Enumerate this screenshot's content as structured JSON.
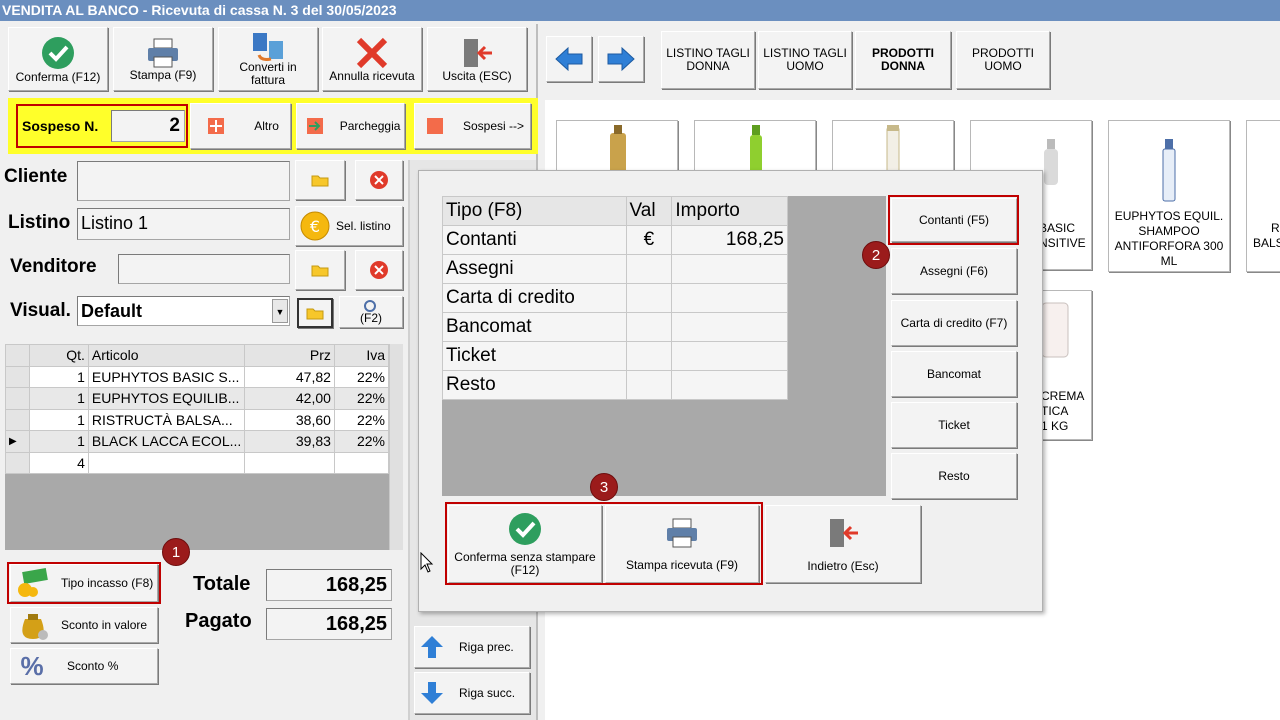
{
  "window": {
    "title": "VENDITA AL BANCO - Ricevuta di cassa N. 3 del 30/05/2023"
  },
  "toolbar": {
    "confirm": "Conferma (F12)",
    "print": "Stampa (F9)",
    "convert_line1": "Converti in",
    "convert_line2": "fattura",
    "cancel": "Annulla ricevuta",
    "exit": "Uscita (ESC)"
  },
  "nav": {
    "listino_tagli_donna_1": "LISTINO TAGLI",
    "listino_tagli_donna_2": "DONNA",
    "listino_tagli_uomo_1": "LISTINO TAGLI",
    "listino_tagli_uomo_2": "UOMO",
    "prodotti_donna_1": "PRODOTTI",
    "prodotti_donna_2": "DONNA",
    "prodotti_uomo_1": "PRODOTTI",
    "prodotti_uomo_2": "UOMO"
  },
  "suspend": {
    "label": "Sospeso N.",
    "number": "2",
    "altro": "Altro",
    "parcheggia": "Parcheggia",
    "sospesi": "Sospesi -->"
  },
  "form": {
    "cliente_label": "Cliente",
    "cliente_value": "",
    "listino_label": "Listino",
    "listino_value": "Listino 1",
    "sel_listino": "Sel. listino",
    "venditore_label": "Venditore",
    "venditore_value": "",
    "visual_label": "Visual.",
    "visual_value": "Default",
    "f2_label": "(F2)"
  },
  "items_table": {
    "headers": [
      "Qt.",
      "Articolo",
      "Prz",
      "Iva"
    ],
    "rows": [
      {
        "qt": "1",
        "articolo": "EUPHYTOS BASIC S...",
        "prz": "47,82",
        "iva": "22%"
      },
      {
        "qt": "1",
        "articolo": "EUPHYTOS EQUILIB...",
        "prz": "42,00",
        "iva": "22%"
      },
      {
        "qt": "1",
        "articolo": "RISTRUCTÀ BALSA...",
        "prz": "38,60",
        "iva": "22%"
      },
      {
        "qt": "1",
        "articolo": "BLACK LACCA ECOL...",
        "prz": "39,83",
        "iva": "22%"
      },
      {
        "qt": "4",
        "articolo": "",
        "prz": "",
        "iva": ""
      }
    ]
  },
  "left_buttons": {
    "tipo_incasso": "Tipo incasso (F8)",
    "sconto_valore": "Sconto in valore",
    "sconto_perc": "Sconto %"
  },
  "totals": {
    "totale_label": "Totale",
    "totale_value": "168,25",
    "pagato_label": "Pagato",
    "pagato_value": "168,25"
  },
  "row_nav": {
    "prev": "Riga prec.",
    "next": "Riga succ."
  },
  "products": [
    {
      "name_1": "EUPHYTOS EQUIL.",
      "name_2": "SHAMPOO",
      "name_3": "ANTIFORFORA 300",
      "name_4": "ML"
    }
  ],
  "product_fragments": {
    "basic_1": "BASIC",
    "basic_2": "NSITIVE",
    "r_1": "R",
    "r_2": "BALS",
    "crema_1": "CREMA",
    "crema_2": "TICA",
    "crema_3": "1 KG"
  },
  "dialog": {
    "headers": [
      "Tipo (F8)",
      "Val",
      "Importo"
    ],
    "rows": [
      {
        "tipo": "Contanti",
        "val": "€",
        "importo": "168,25"
      },
      {
        "tipo": "Assegni",
        "val": "",
        "importo": ""
      },
      {
        "tipo": "Carta di credito",
        "val": "",
        "importo": ""
      },
      {
        "tipo": "Bancomat",
        "val": "",
        "importo": ""
      },
      {
        "tipo": "Ticket",
        "val": "",
        "importo": ""
      },
      {
        "tipo": "Resto",
        "val": "",
        "importo": ""
      }
    ],
    "side_buttons": {
      "contanti": "Contanti (F5)",
      "assegni": "Assegni (F6)",
      "carta": "Carta di credito (F7)",
      "bancomat": "Bancomat",
      "ticket": "Ticket",
      "resto": "Resto"
    },
    "confirm_no_print_1": "Conferma senza stampare",
    "confirm_no_print_2": "(F12)",
    "print_receipt": "Stampa ricevuta (F9)",
    "back": "Indietro (Esc)"
  },
  "badges": {
    "one": "1",
    "two": "2",
    "three": "3"
  },
  "colors": {
    "highlight_yellow": "#ffff2a",
    "annotation_red": "#c00000",
    "badge_red": "#9b1b1b",
    "accent_green": "#2e9e5e",
    "arrow_blue": "#2f7fd6"
  }
}
